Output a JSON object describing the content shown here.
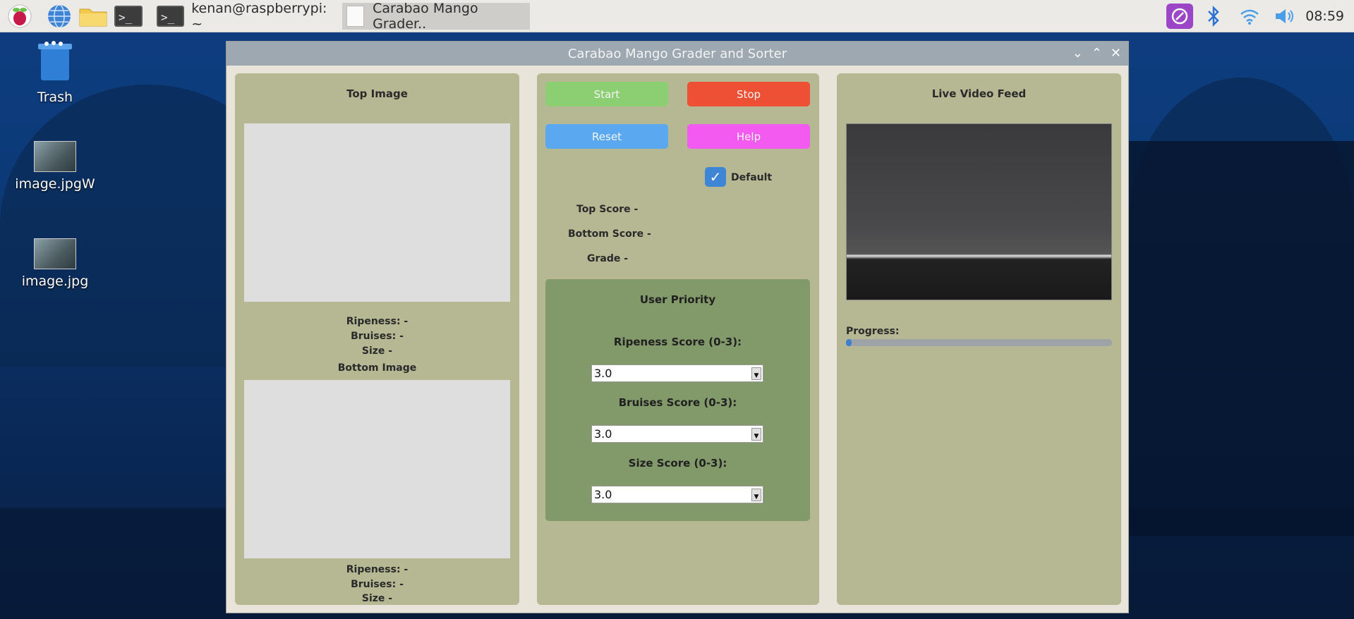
{
  "taskbar": {
    "terminal_task": "kenan@raspberrypi: ~",
    "app_task": "Carabao Mango Grader..",
    "clock": "08:59",
    "icons": [
      "raspberry-menu-icon",
      "globe-icon",
      "folder-icon",
      "terminal-icon",
      "bluetooth-icon",
      "wifi-icon",
      "volume-icon"
    ]
  },
  "desktop": {
    "items": [
      {
        "label": "Trash"
      },
      {
        "label": "image.jpgW"
      },
      {
        "label": "image.jpg"
      }
    ]
  },
  "window": {
    "title": "Carabao Mango Grader and Sorter"
  },
  "left_panel": {
    "top_title": "Top Image",
    "top_ripeness": "Ripeness: -",
    "top_bruises": "Bruises: -",
    "top_size": "Size -",
    "bottom_title": "Bottom Image",
    "bottom_ripeness": "Ripeness: -",
    "bottom_bruises": "Bruises: -",
    "bottom_size": "Size -"
  },
  "middle_panel": {
    "start": "Start",
    "stop": "Stop",
    "reset": "Reset",
    "help": "Help",
    "default_label": "Default",
    "default_checked": true,
    "top_score": "Top Score -",
    "bottom_score": "Bottom Score -",
    "grade": "Grade -",
    "priority_title": "User Priority",
    "ripeness_label": "Ripeness Score (0-3):",
    "ripeness_value": "3.0",
    "bruises_label": "Bruises Score (0-3):",
    "bruises_value": "3.0",
    "size_label": "Size Score (0-3):",
    "size_value": "3.0"
  },
  "right_panel": {
    "title": "Live Video Feed",
    "progress_label": "Progress:",
    "progress_fraction": 0.02
  },
  "colors": {
    "panel": "#b6b893",
    "priority": "#82996a",
    "start": "#8ccf72",
    "stop": "#ee5035",
    "reset": "#5aa9f0",
    "help": "#f25af0"
  }
}
